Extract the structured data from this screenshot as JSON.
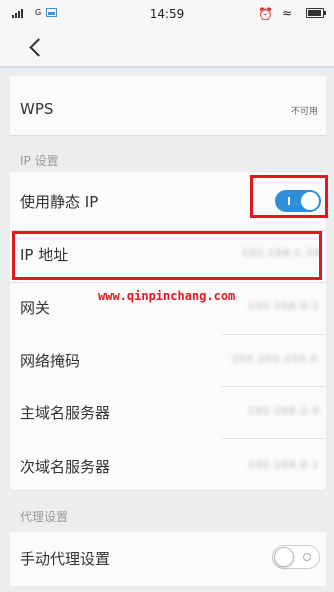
{
  "status_bar": {
    "network": "G",
    "time": "14:59",
    "alarm_icon": "alarm-clock-icon",
    "wifi_icon": "wifi-icon",
    "battery_icon": "battery-icon"
  },
  "toolbar": {
    "back_icon": "chevron-left-icon"
  },
  "wps": {
    "label": "WPS",
    "value": "不可用"
  },
  "ip_section": {
    "header": "IP 设置",
    "static_ip": {
      "label": "使用静态 IP",
      "enabled": true
    },
    "rows": [
      {
        "label": "IP 地址",
        "value": "192.168.1.10"
      },
      {
        "label": "网关",
        "value": "192.168.0.1"
      },
      {
        "label": "网络掩码",
        "value": "255.255.255.0"
      },
      {
        "label": "主域名服务器",
        "value": "192.168.2.0"
      },
      {
        "label": "次域名服务器",
        "value": "192.168.0.1"
      }
    ]
  },
  "proxy_section": {
    "header": "代理设置",
    "manual_proxy": {
      "label": "手动代理设置",
      "enabled": false
    }
  },
  "watermark": "www.qinpinchang.com",
  "colors": {
    "accent": "#2f8fd8",
    "highlight": "#e0191f"
  }
}
